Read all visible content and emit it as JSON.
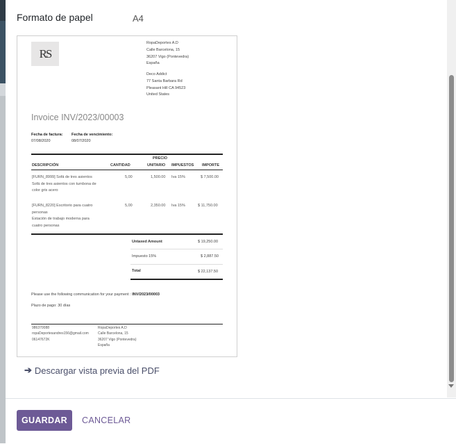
{
  "dialog": {
    "paper_format_label": "Formato de papel",
    "paper_format_value": "A4",
    "download_link": "Descargar vista previa del PDF",
    "save_button": "GUARDAR",
    "cancel_button": "CANCELAR"
  },
  "invoice": {
    "logo_text": "RS",
    "company_lines": [
      "RopaDeportes A.D",
      "Calle Barcelona, 15",
      "36207 Vigo (Pontevedra)",
      "España"
    ],
    "customer_lines": [
      "Deco Addict",
      "77 Santa Barbara Rd",
      "Pleasant Hill CA 94523",
      "United States"
    ],
    "title": "Invoice INV/2023/00003",
    "invoice_date_label": "Fecha de factura:",
    "invoice_date": "07/08/2020",
    "due_date_label": "Fecha de vencimiento:",
    "due_date": "08/07/2020",
    "columns": {
      "description": "DESCRIPCIÓN",
      "quantity": "CANTIDAD",
      "unit_price_1": "PRECIO",
      "unit_price_2": "UNITARIO",
      "taxes": "IMPUESTOS",
      "amount": "IMPORTE"
    },
    "lines": [
      {
        "desc_lines": [
          "[FURN_8999] Sofá de tres asientos",
          "Sofá de tres asientos con tumbona de",
          "color gris acero"
        ],
        "quantity": "5,00",
        "unit_price": "1,500.00",
        "taxes": "Iva 15%",
        "amount": "$ 7,500.00"
      },
      {
        "desc_lines": [
          "[FURN_8220] Escritorio para cuatro",
          "personas",
          "Estación de trabajo moderna para",
          "cuatro personas"
        ],
        "quantity": "5,00",
        "unit_price": "2,350.00",
        "taxes": "Iva 15%",
        "amount": "$ 11,750.00"
      }
    ],
    "totals": {
      "untaxed_label": "Untaxed Amount",
      "untaxed_value": "$ 19,250.00",
      "tax_label": "Impuesto 15%",
      "tax_value": "$ 2,887.50",
      "total_label": "Total",
      "total_value": "$ 22,137.50"
    },
    "payment_text": "Please use the following communication for your payment :",
    "payment_ref": "INV/2023/00003",
    "payment_terms": "Plazo de pago: 30 días",
    "footer_left": [
      "986370088",
      "ropaDeportesandres156@gmail.com",
      "06147672K"
    ],
    "footer_right": [
      "RopaDeportes A.D",
      "Calle Barcelona, 15",
      "36207 Vigo (Pontevedra)",
      "España"
    ]
  }
}
